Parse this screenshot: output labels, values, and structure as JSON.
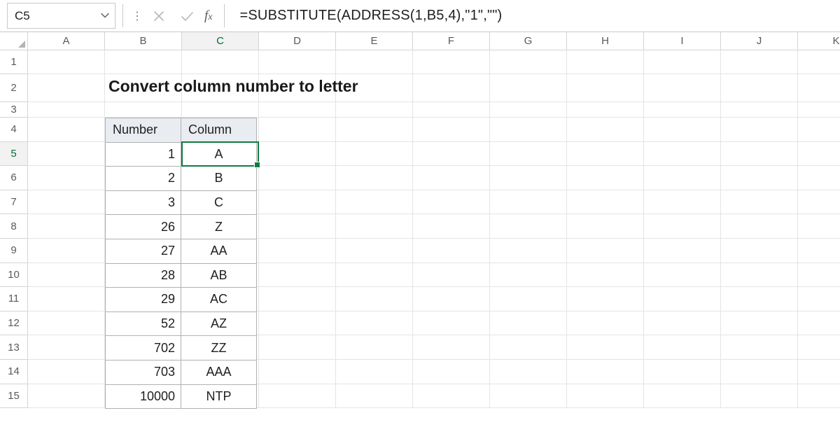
{
  "namebox": {
    "value": "C5"
  },
  "formula_bar": {
    "formula": "=SUBSTITUTE(ADDRESS(1,B5,4),\"1\",\"\")"
  },
  "columns": [
    "A",
    "B",
    "C",
    "D",
    "E",
    "F",
    "G",
    "H",
    "I",
    "J",
    "K"
  ],
  "rows_visible": [
    "1",
    "2",
    "3",
    "4",
    "5",
    "6",
    "7",
    "8",
    "9",
    "10",
    "11",
    "12",
    "13",
    "14",
    "15"
  ],
  "active": {
    "col": "C",
    "row": "5"
  },
  "title": "Convert column number to letter",
  "table": {
    "headers": {
      "number": "Number",
      "column": "Column"
    },
    "rows": [
      {
        "number": "1",
        "column": "A"
      },
      {
        "number": "2",
        "column": "B"
      },
      {
        "number": "3",
        "column": "C"
      },
      {
        "number": "26",
        "column": "Z"
      },
      {
        "number": "27",
        "column": "AA"
      },
      {
        "number": "28",
        "column": "AB"
      },
      {
        "number": "29",
        "column": "AC"
      },
      {
        "number": "52",
        "column": "AZ"
      },
      {
        "number": "702",
        "column": "ZZ"
      },
      {
        "number": "703",
        "column": "AAA"
      },
      {
        "number": "10000",
        "column": "NTP"
      }
    ]
  }
}
